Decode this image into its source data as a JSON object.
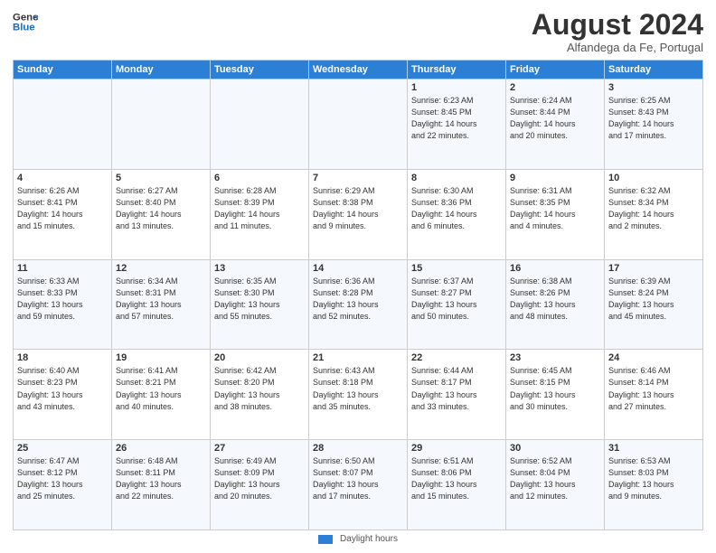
{
  "header": {
    "logo_line1": "General",
    "logo_line2": "Blue",
    "month_year": "August 2024",
    "location": "Alfandega da Fe, Portugal"
  },
  "days_of_week": [
    "Sunday",
    "Monday",
    "Tuesday",
    "Wednesday",
    "Thursday",
    "Friday",
    "Saturday"
  ],
  "footer": {
    "label": "Daylight hours"
  },
  "weeks": [
    [
      {
        "day": "",
        "info": ""
      },
      {
        "day": "",
        "info": ""
      },
      {
        "day": "",
        "info": ""
      },
      {
        "day": "",
        "info": ""
      },
      {
        "day": "1",
        "info": "Sunrise: 6:23 AM\nSunset: 8:45 PM\nDaylight: 14 hours\nand 22 minutes."
      },
      {
        "day": "2",
        "info": "Sunrise: 6:24 AM\nSunset: 8:44 PM\nDaylight: 14 hours\nand 20 minutes."
      },
      {
        "day": "3",
        "info": "Sunrise: 6:25 AM\nSunset: 8:43 PM\nDaylight: 14 hours\nand 17 minutes."
      }
    ],
    [
      {
        "day": "4",
        "info": "Sunrise: 6:26 AM\nSunset: 8:41 PM\nDaylight: 14 hours\nand 15 minutes."
      },
      {
        "day": "5",
        "info": "Sunrise: 6:27 AM\nSunset: 8:40 PM\nDaylight: 14 hours\nand 13 minutes."
      },
      {
        "day": "6",
        "info": "Sunrise: 6:28 AM\nSunset: 8:39 PM\nDaylight: 14 hours\nand 11 minutes."
      },
      {
        "day": "7",
        "info": "Sunrise: 6:29 AM\nSunset: 8:38 PM\nDaylight: 14 hours\nand 9 minutes."
      },
      {
        "day": "8",
        "info": "Sunrise: 6:30 AM\nSunset: 8:36 PM\nDaylight: 14 hours\nand 6 minutes."
      },
      {
        "day": "9",
        "info": "Sunrise: 6:31 AM\nSunset: 8:35 PM\nDaylight: 14 hours\nand 4 minutes."
      },
      {
        "day": "10",
        "info": "Sunrise: 6:32 AM\nSunset: 8:34 PM\nDaylight: 14 hours\nand 2 minutes."
      }
    ],
    [
      {
        "day": "11",
        "info": "Sunrise: 6:33 AM\nSunset: 8:33 PM\nDaylight: 13 hours\nand 59 minutes."
      },
      {
        "day": "12",
        "info": "Sunrise: 6:34 AM\nSunset: 8:31 PM\nDaylight: 13 hours\nand 57 minutes."
      },
      {
        "day": "13",
        "info": "Sunrise: 6:35 AM\nSunset: 8:30 PM\nDaylight: 13 hours\nand 55 minutes."
      },
      {
        "day": "14",
        "info": "Sunrise: 6:36 AM\nSunset: 8:28 PM\nDaylight: 13 hours\nand 52 minutes."
      },
      {
        "day": "15",
        "info": "Sunrise: 6:37 AM\nSunset: 8:27 PM\nDaylight: 13 hours\nand 50 minutes."
      },
      {
        "day": "16",
        "info": "Sunrise: 6:38 AM\nSunset: 8:26 PM\nDaylight: 13 hours\nand 48 minutes."
      },
      {
        "day": "17",
        "info": "Sunrise: 6:39 AM\nSunset: 8:24 PM\nDaylight: 13 hours\nand 45 minutes."
      }
    ],
    [
      {
        "day": "18",
        "info": "Sunrise: 6:40 AM\nSunset: 8:23 PM\nDaylight: 13 hours\nand 43 minutes."
      },
      {
        "day": "19",
        "info": "Sunrise: 6:41 AM\nSunset: 8:21 PM\nDaylight: 13 hours\nand 40 minutes."
      },
      {
        "day": "20",
        "info": "Sunrise: 6:42 AM\nSunset: 8:20 PM\nDaylight: 13 hours\nand 38 minutes."
      },
      {
        "day": "21",
        "info": "Sunrise: 6:43 AM\nSunset: 8:18 PM\nDaylight: 13 hours\nand 35 minutes."
      },
      {
        "day": "22",
        "info": "Sunrise: 6:44 AM\nSunset: 8:17 PM\nDaylight: 13 hours\nand 33 minutes."
      },
      {
        "day": "23",
        "info": "Sunrise: 6:45 AM\nSunset: 8:15 PM\nDaylight: 13 hours\nand 30 minutes."
      },
      {
        "day": "24",
        "info": "Sunrise: 6:46 AM\nSunset: 8:14 PM\nDaylight: 13 hours\nand 27 minutes."
      }
    ],
    [
      {
        "day": "25",
        "info": "Sunrise: 6:47 AM\nSunset: 8:12 PM\nDaylight: 13 hours\nand 25 minutes."
      },
      {
        "day": "26",
        "info": "Sunrise: 6:48 AM\nSunset: 8:11 PM\nDaylight: 13 hours\nand 22 minutes."
      },
      {
        "day": "27",
        "info": "Sunrise: 6:49 AM\nSunset: 8:09 PM\nDaylight: 13 hours\nand 20 minutes."
      },
      {
        "day": "28",
        "info": "Sunrise: 6:50 AM\nSunset: 8:07 PM\nDaylight: 13 hours\nand 17 minutes."
      },
      {
        "day": "29",
        "info": "Sunrise: 6:51 AM\nSunset: 8:06 PM\nDaylight: 13 hours\nand 15 minutes."
      },
      {
        "day": "30",
        "info": "Sunrise: 6:52 AM\nSunset: 8:04 PM\nDaylight: 13 hours\nand 12 minutes."
      },
      {
        "day": "31",
        "info": "Sunrise: 6:53 AM\nSunset: 8:03 PM\nDaylight: 13 hours\nand 9 minutes."
      }
    ]
  ]
}
